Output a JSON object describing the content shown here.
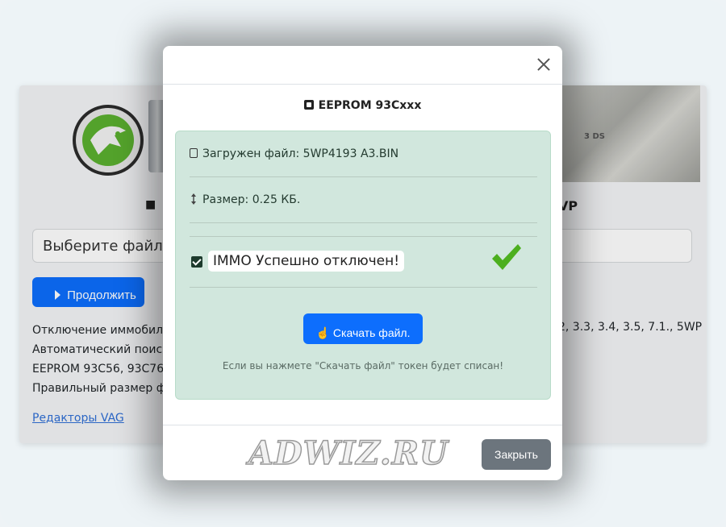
{
  "background": {
    "input_placeholder": "Выберите файл",
    "continue_label": "Продолжить",
    "text_lines": [
      "Отключение иммобил",
      "Автоматический поис",
      "EEPROM 93C56, 93C76",
      "Правильный размер ф"
    ],
    "right_text": "2, 3.3, 3.4, 3.5, 7.1., 5WP",
    "right_heading": "VP",
    "ecu_label": "3 DS",
    "link_label": "Редакторы VAG"
  },
  "modal": {
    "title": "EEPROM 93Cxxx",
    "file_loaded": "Загружен файл: 5WP4193 A3.BIN",
    "size": "Размер: 0.25 КБ.",
    "immo_status": "IMMO Успешно отключен!",
    "download_label": "Скачать файл.",
    "note": "Если вы нажмете \"Скачать файл\" токен будет списан!",
    "close_label": "Закрыть",
    "watermark": "ADWIZ.RU"
  },
  "colors": {
    "primary": "#0d6efd",
    "success_bg": "#d1e7dd",
    "check_green": "#4caf1e",
    "secondary": "#6c757d"
  }
}
